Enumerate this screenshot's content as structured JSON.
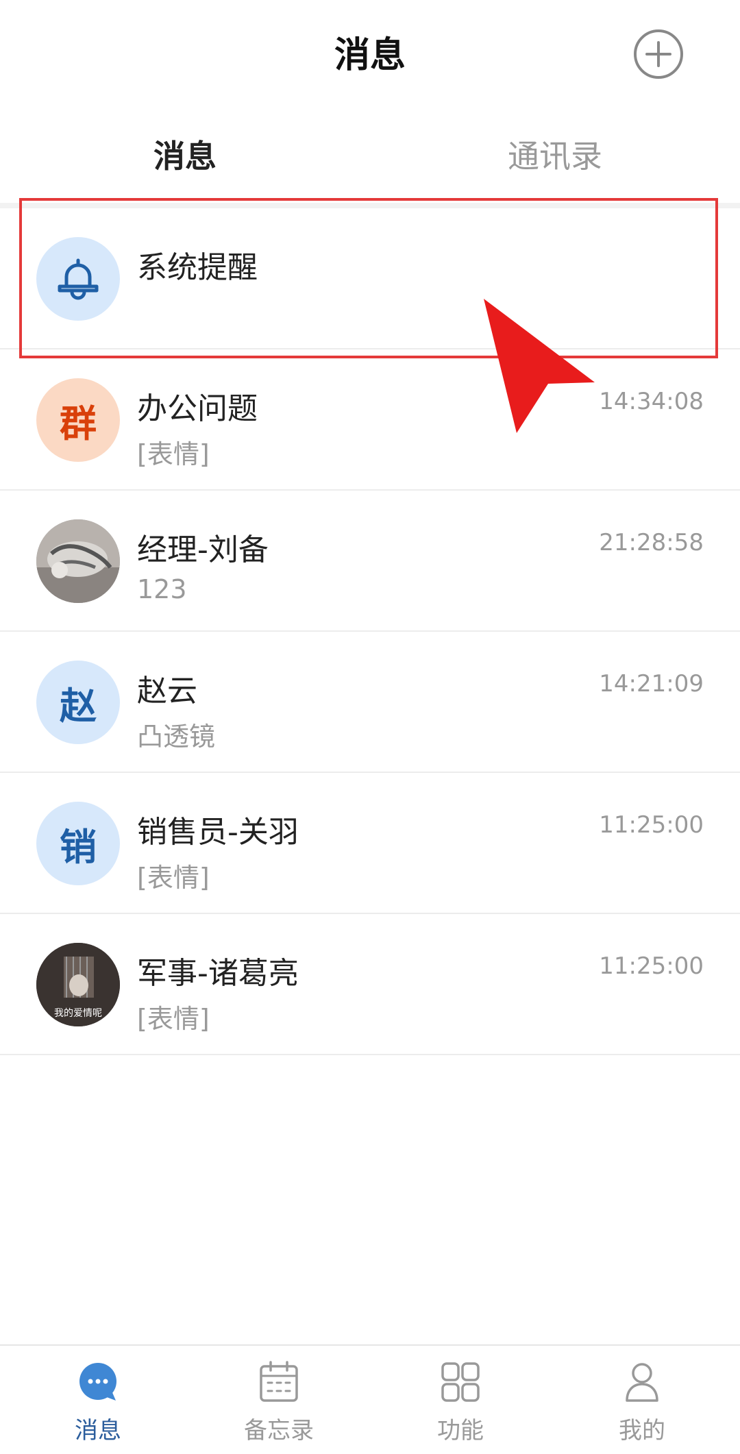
{
  "header": {
    "title": "消息"
  },
  "tabs": [
    {
      "label": "消息",
      "active": true
    },
    {
      "label": "通讯录",
      "active": false
    }
  ],
  "conversations": [
    {
      "name": "系统提醒",
      "preview": "",
      "time": "",
      "avatar": "bell-icon"
    },
    {
      "name": "办公问题",
      "preview": "[表情]",
      "time": "14:34:08",
      "avatar_text": "群"
    },
    {
      "name": "经理-刘备",
      "preview": "123",
      "time": "21:28:58",
      "avatar": "photo"
    },
    {
      "name": "赵云",
      "preview": "凸透镜",
      "time": "14:21:09",
      "avatar_text": "赵"
    },
    {
      "name": "销售员-关羽",
      "preview": "[表情]",
      "time": "11:25:00",
      "avatar_text": "销"
    },
    {
      "name": "军事-诸葛亮",
      "preview": "[表情]",
      "time": "11:25:00",
      "avatar": "photo",
      "avatar_caption": "我的爱情呢"
    }
  ],
  "bottom_nav": [
    {
      "label": "消息",
      "icon": "chat-bubble-icon",
      "active": true
    },
    {
      "label": "备忘录",
      "icon": "calendar-icon",
      "active": false
    },
    {
      "label": "功能",
      "icon": "grid-icon",
      "active": false
    },
    {
      "label": "我的",
      "icon": "person-icon",
      "active": false
    }
  ],
  "colors": {
    "accent": "#2b5d9c",
    "highlight": "#e43a3a",
    "avatar_blue_bg": "#d7e8fb",
    "avatar_orange_bg": "#fbd9c4"
  }
}
